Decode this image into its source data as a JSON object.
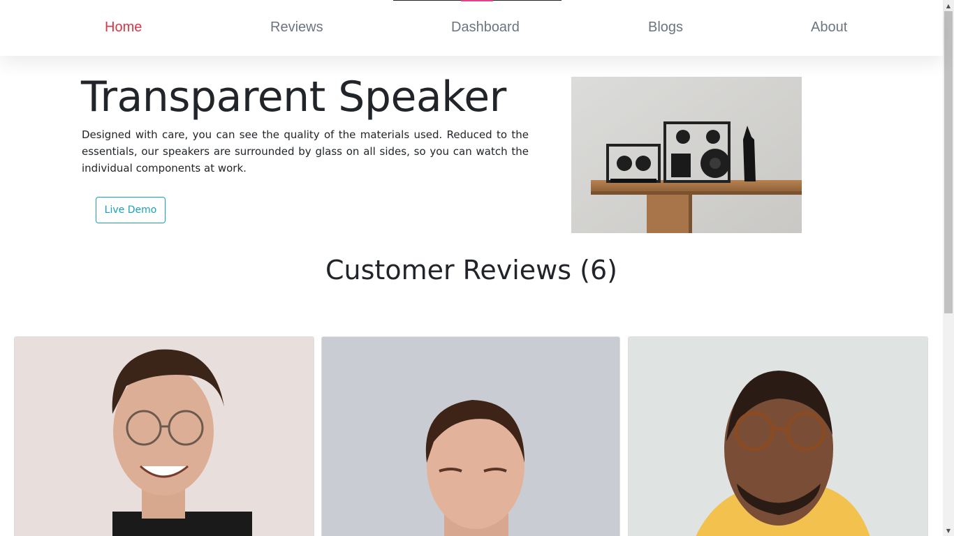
{
  "nav": {
    "items": [
      {
        "label": "Home",
        "active": true
      },
      {
        "label": "Reviews",
        "active": false
      },
      {
        "label": "Dashboard",
        "active": false
      },
      {
        "label": "Blogs",
        "active": false
      },
      {
        "label": "About",
        "active": false
      }
    ],
    "active_color": "#dc3545",
    "link_color": "#6c757d"
  },
  "hero": {
    "title": "Transparent Speaker",
    "description": "Designed with care, you can see the quality of the materials used. Reduced to the essentials, our speakers are surrounded by glass on all sides, so you can watch the individual components at work.",
    "button_label": "Live Demo",
    "button_color": "#17a2b8",
    "image_icon": "speaker-product-photo"
  },
  "reviews": {
    "heading": "Customer Reviews (6)",
    "cards": [
      {
        "photo": "reviewer-photo-smiling-man-glasses"
      },
      {
        "photo": "reviewer-photo-young-man"
      },
      {
        "photo": "reviewer-photo-man-round-glasses"
      }
    ]
  }
}
